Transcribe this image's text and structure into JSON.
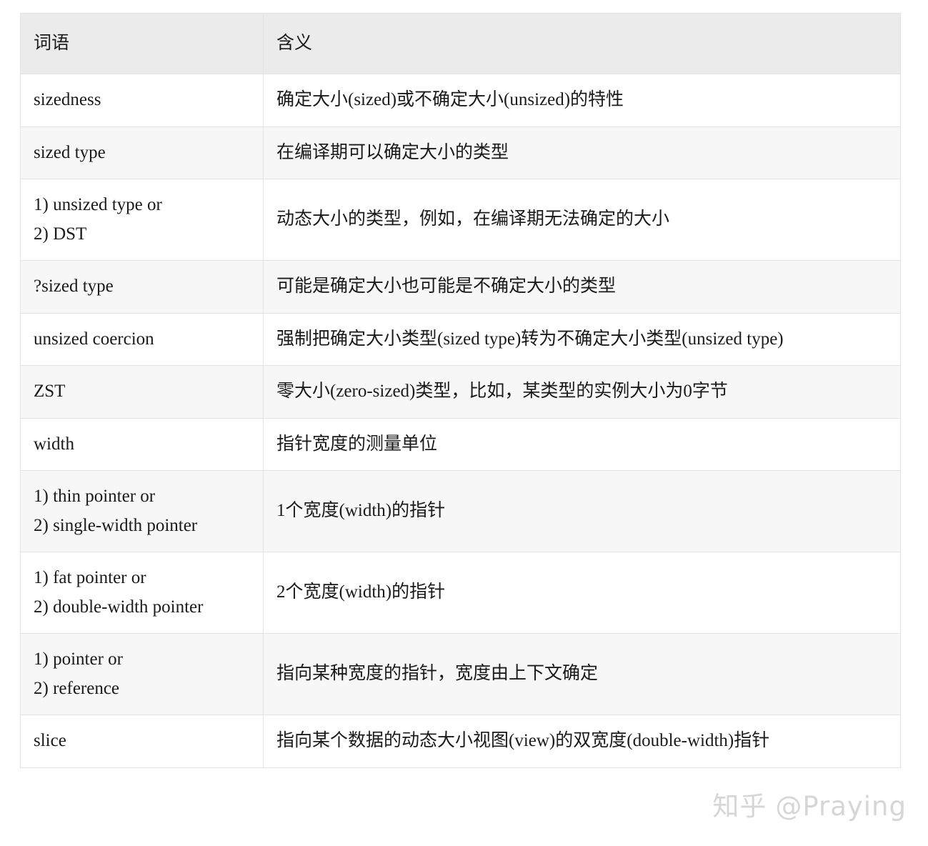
{
  "table": {
    "columns": [
      "词语",
      "含义"
    ],
    "rows": [
      {
        "term": "sizedness",
        "meaning": "确定大小(sized)或不确定大小(unsized)的特性"
      },
      {
        "term": "sized type",
        "meaning": "在编译期可以确定大小的类型"
      },
      {
        "term": "1) unsized type or\n2) DST",
        "meaning": "动态大小的类型，例如，在编译期无法确定的大小"
      },
      {
        "term": "?sized type",
        "meaning": "可能是确定大小也可能是不确定大小的类型"
      },
      {
        "term": "unsized coercion",
        "meaning": "强制把确定大小类型(sized type)转为不确定大小类型(unsized type)"
      },
      {
        "term": "ZST",
        "meaning": "零大小(zero-sized)类型，比如，某类型的实例大小为0字节"
      },
      {
        "term": "width",
        "meaning": "指针宽度的测量单位"
      },
      {
        "term": "1) thin pointer or\n2) single-width pointer",
        "meaning": "1个宽度(width)的指针"
      },
      {
        "term": "1) fat pointer or\n2) double-width pointer",
        "meaning": "2个宽度(width)的指针"
      },
      {
        "term": "1) pointer or\n2) reference",
        "meaning": "指向某种宽度的指针，宽度由上下文确定"
      },
      {
        "term": "slice",
        "meaning": "指向某个数据的动态大小视图(view)的双宽度(double-width)指针"
      }
    ]
  },
  "watermark": {
    "logo": "知乎",
    "handle": "@Praying"
  },
  "colors": {
    "header_bg": "#ebebeb",
    "row_shaded_bg": "#f7f7f7",
    "row_plain_bg": "#ffffff",
    "border": "#e3e3e3",
    "text": "#1a1a1a",
    "watermark": "#d6d6d6"
  }
}
